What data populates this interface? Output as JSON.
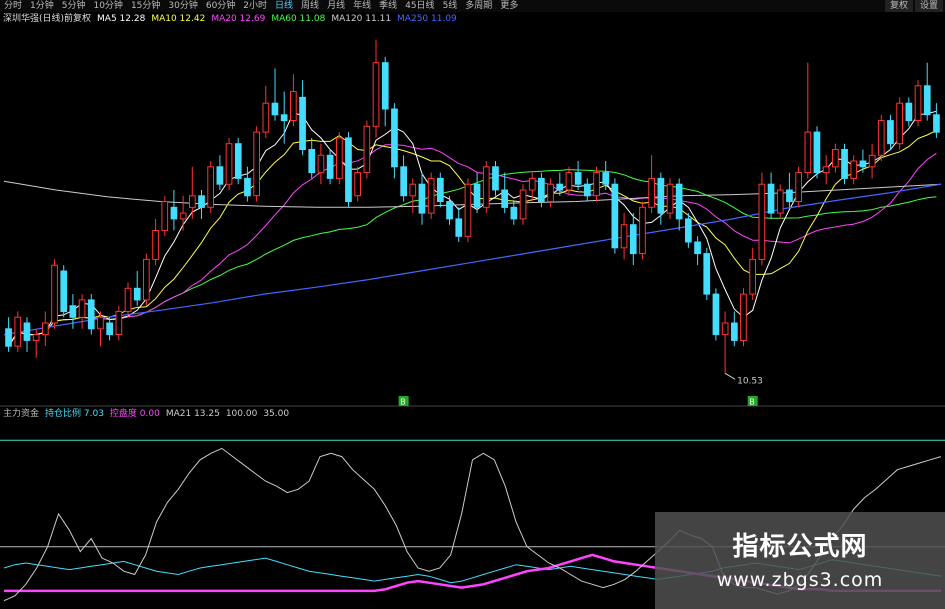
{
  "toolbar": {
    "items": [
      "分时",
      "1分钟",
      "5分钟",
      "10分钟",
      "15分钟",
      "30分钟",
      "60分钟",
      "2小时",
      "日线",
      "周线",
      "月线",
      "年线",
      "季线",
      "45日线",
      "5线",
      "多周期",
      "更多"
    ],
    "active_index": 8,
    "right": [
      "复权",
      "设置"
    ]
  },
  "ma_legend": [
    {
      "text": "深圳华强(日线)前复权",
      "color": "#dddddd"
    },
    {
      "text": "MA5 12.28",
      "color": "#ffffff"
    },
    {
      "text": "MA10 12.42",
      "color": "#ffff44"
    },
    {
      "text": "MA20 12.69",
      "color": "#ff44ff"
    },
    {
      "text": "MA60 11.08",
      "color": "#44ff44"
    },
    {
      "text": "MA120 11.11",
      "color": "#cccccc"
    },
    {
      "text": "MA250 11.09",
      "color": "#4466ff"
    }
  ],
  "ind_legend": [
    {
      "text": "主力资金",
      "color": "#bbbbbb"
    },
    {
      "text": "持仓比例 7.03",
      "color": "#44ddff"
    },
    {
      "text": "控盘度 0.00",
      "color": "#ff44ff"
    },
    {
      "text": "MA21 13.25",
      "color": "#cccccc"
    },
    {
      "text": "100.00",
      "color": "#cccccc"
    },
    {
      "text": "35.00",
      "color": "#cccccc"
    }
  ],
  "annotations": {
    "low_price": "10.53",
    "buy_1": "B",
    "buy_2": "B"
  },
  "watermark": {
    "title": "指标公式网",
    "url": "www.zbgs3.com"
  },
  "colors": {
    "up": "#ff3333",
    "down": "#44ddff",
    "ma5": "#ffffff",
    "ma10": "#ffff44",
    "ma20": "#ff44ff",
    "ma60": "#44ff44",
    "ma120": "#cccccc",
    "ma250": "#4466ff",
    "ref_line": "#40e0d0"
  },
  "chart_data": [
    {
      "type": "candlestick",
      "title": "深圳华强(日线)",
      "ylim": [
        10.0,
        16.5
      ],
      "ohlc": [
        [
          11.3,
          11.5,
          10.9,
          11.0
        ],
        [
          11.0,
          11.6,
          10.9,
          11.5
        ],
        [
          11.4,
          11.5,
          10.9,
          11.1
        ],
        [
          11.1,
          11.3,
          10.8,
          11.2
        ],
        [
          11.2,
          11.6,
          11.0,
          11.4
        ],
        [
          11.4,
          12.5,
          11.3,
          12.4
        ],
        [
          12.3,
          12.4,
          11.5,
          11.6
        ],
        [
          11.7,
          11.9,
          11.3,
          11.5
        ],
        [
          11.5,
          11.9,
          11.3,
          11.8
        ],
        [
          11.8,
          11.9,
          11.2,
          11.3
        ],
        [
          11.3,
          11.6,
          11.0,
          11.5
        ],
        [
          11.4,
          11.5,
          11.1,
          11.2
        ],
        [
          11.2,
          11.7,
          11.1,
          11.6
        ],
        [
          11.6,
          12.1,
          11.5,
          12.0
        ],
        [
          12.0,
          12.3,
          11.7,
          11.8
        ],
        [
          11.8,
          12.6,
          11.7,
          12.5
        ],
        [
          12.5,
          13.2,
          12.4,
          13.0
        ],
        [
          13.0,
          13.6,
          12.9,
          13.5
        ],
        [
          13.4,
          13.7,
          13.0,
          13.2
        ],
        [
          13.2,
          13.6,
          13.0,
          13.3
        ],
        [
          13.4,
          14.1,
          13.2,
          13.6
        ],
        [
          13.6,
          13.7,
          13.2,
          13.4
        ],
        [
          13.4,
          14.2,
          13.3,
          14.1
        ],
        [
          14.1,
          14.3,
          13.7,
          13.8
        ],
        [
          13.8,
          14.6,
          13.7,
          14.5
        ],
        [
          14.5,
          14.6,
          13.8,
          13.9
        ],
        [
          13.9,
          14.1,
          13.5,
          13.6
        ],
        [
          13.6,
          14.8,
          13.5,
          14.7
        ],
        [
          14.7,
          15.5,
          14.6,
          15.2
        ],
        [
          15.2,
          15.8,
          14.9,
          15.0
        ],
        [
          15.0,
          15.4,
          14.5,
          14.9
        ],
        [
          14.9,
          15.7,
          14.8,
          15.4
        ],
        [
          15.3,
          15.6,
          14.3,
          14.4
        ],
        [
          14.4,
          14.6,
          13.9,
          14.0
        ],
        [
          14.0,
          14.5,
          13.8,
          14.3
        ],
        [
          14.3,
          14.4,
          13.8,
          13.9
        ],
        [
          13.9,
          14.7,
          13.8,
          14.6
        ],
        [
          14.6,
          14.7,
          13.4,
          13.5
        ],
        [
          13.6,
          14.1,
          13.5,
          14.0
        ],
        [
          14.0,
          14.9,
          13.9,
          14.8
        ],
        [
          14.8,
          16.3,
          14.6,
          15.9
        ],
        [
          15.9,
          16.0,
          14.8,
          15.1
        ],
        [
          15.1,
          15.2,
          13.9,
          14.1
        ],
        [
          14.1,
          14.3,
          13.5,
          13.6
        ],
        [
          13.6,
          13.9,
          13.3,
          13.8
        ],
        [
          13.8,
          14.0,
          13.1,
          13.3
        ],
        [
          13.3,
          14.0,
          13.2,
          13.9
        ],
        [
          13.9,
          14.0,
          13.4,
          13.5
        ],
        [
          13.5,
          13.6,
          13.1,
          13.2
        ],
        [
          13.2,
          13.4,
          12.8,
          12.9
        ],
        [
          12.9,
          13.9,
          12.8,
          13.8
        ],
        [
          13.8,
          14.0,
          13.3,
          13.4
        ],
        [
          13.4,
          14.2,
          13.3,
          14.1
        ],
        [
          14.1,
          14.2,
          13.6,
          13.7
        ],
        [
          13.7,
          14.0,
          13.3,
          13.4
        ],
        [
          13.4,
          13.5,
          13.1,
          13.2
        ],
        [
          13.2,
          13.8,
          13.1,
          13.7
        ],
        [
          13.7,
          14.0,
          13.5,
          13.9
        ],
        [
          13.9,
          14.0,
          13.4,
          13.5
        ],
        [
          13.5,
          13.9,
          13.4,
          13.8
        ],
        [
          13.8,
          14.0,
          13.6,
          13.7
        ],
        [
          13.7,
          14.1,
          13.6,
          14.0
        ],
        [
          14.0,
          14.2,
          13.7,
          13.8
        ],
        [
          13.8,
          13.9,
          13.5,
          13.6
        ],
        [
          13.6,
          14.1,
          13.5,
          14.0
        ],
        [
          14.0,
          14.2,
          13.7,
          13.8
        ],
        [
          13.8,
          13.9,
          12.6,
          12.7
        ],
        [
          12.7,
          13.3,
          12.5,
          13.1
        ],
        [
          13.1,
          13.3,
          12.4,
          12.6
        ],
        [
          12.6,
          13.5,
          12.5,
          13.4
        ],
        [
          13.4,
          14.3,
          13.3,
          13.9
        ],
        [
          13.9,
          14.0,
          13.1,
          13.3
        ],
        [
          13.3,
          13.9,
          13.2,
          13.8
        ],
        [
          13.8,
          13.9,
          13.0,
          13.2
        ],
        [
          13.2,
          13.3,
          12.7,
          12.8
        ],
        [
          12.8,
          12.9,
          12.4,
          12.6
        ],
        [
          12.6,
          12.7,
          11.8,
          11.9
        ],
        [
          11.9,
          12.0,
          11.1,
          11.2
        ],
        [
          11.2,
          11.6,
          10.53,
          11.4
        ],
        [
          11.4,
          11.6,
          11.0,
          11.1
        ],
        [
          11.1,
          12.0,
          11.0,
          11.9
        ],
        [
          11.9,
          12.7,
          11.8,
          12.5
        ],
        [
          12.5,
          14.0,
          12.4,
          13.8
        ],
        [
          13.8,
          14.0,
          13.2,
          13.3
        ],
        [
          13.3,
          13.8,
          13.2,
          13.7
        ],
        [
          13.7,
          14.0,
          13.4,
          13.5
        ],
        [
          13.5,
          14.1,
          13.4,
          14.0
        ],
        [
          14.0,
          15.9,
          13.9,
          14.7
        ],
        [
          14.7,
          14.8,
          13.9,
          14.0
        ],
        [
          14.0,
          14.3,
          13.8,
          14.1
        ],
        [
          14.1,
          14.5,
          14.0,
          14.4
        ],
        [
          14.4,
          14.5,
          13.8,
          13.9
        ],
        [
          13.9,
          14.3,
          13.8,
          14.2
        ],
        [
          14.2,
          14.4,
          14.0,
          14.1
        ],
        [
          14.1,
          14.5,
          13.9,
          14.3
        ],
        [
          14.3,
          15.0,
          14.2,
          14.9
        ],
        [
          14.9,
          15.0,
          14.4,
          14.5
        ],
        [
          14.5,
          15.3,
          14.4,
          15.2
        ],
        [
          15.2,
          15.3,
          14.8,
          14.9
        ],
        [
          14.9,
          15.6,
          14.8,
          15.5
        ],
        [
          15.5,
          15.9,
          14.9,
          15.0
        ],
        [
          15.0,
          15.2,
          14.6,
          14.7
        ]
      ],
      "ma120": [
        13.85,
        13.7,
        13.58,
        13.5,
        13.45,
        13.42,
        13.4,
        13.4,
        13.42,
        13.45,
        13.48,
        13.5,
        13.55,
        13.6,
        13.62,
        13.65,
        13.7,
        13.75,
        13.8
      ],
      "ma250": [
        11.2,
        11.35,
        11.5,
        11.62,
        11.75,
        11.9,
        12.02,
        12.15,
        12.3,
        12.45,
        12.6,
        12.75,
        12.9,
        13.05,
        13.2,
        13.38,
        13.52,
        13.65,
        13.8
      ]
    },
    {
      "type": "line",
      "title": "主力资金",
      "ylim": [
        0,
        105
      ],
      "ref_lines": [
        100,
        35
      ],
      "series": [
        {
          "name": "持仓比例",
          "color": "#44ddff",
          "values": [
            22,
            24,
            25,
            24,
            23,
            22,
            21,
            22,
            23,
            24,
            25,
            26,
            24,
            22,
            20,
            19,
            18,
            20,
            22,
            23,
            24,
            25,
            26,
            27,
            28,
            26,
            24,
            22,
            20,
            19,
            18,
            17,
            16,
            15,
            14,
            15,
            16,
            17,
            18,
            17,
            15,
            13,
            14,
            16,
            18,
            20,
            22,
            24,
            23,
            22,
            21,
            22,
            23,
            22,
            21,
            20,
            19,
            18,
            17,
            16,
            15,
            16,
            17,
            18,
            19,
            20,
            22,
            23,
            24,
            25,
            24,
            23,
            22,
            21,
            23,
            25,
            27,
            26,
            25,
            24,
            23,
            22,
            21,
            20,
            19,
            18,
            17
          ]
        },
        {
          "name": "控盘度",
          "color": "#ff44ff",
          "values": [
            8,
            8,
            8,
            8,
            8,
            8,
            8,
            8,
            8,
            8,
            8,
            8,
            8,
            8,
            8,
            8,
            8,
            8,
            8,
            8,
            8,
            8,
            8,
            8,
            8,
            8,
            8,
            8,
            8,
            8,
            8,
            8,
            8,
            8,
            8,
            9,
            11,
            13,
            14,
            13,
            12,
            11,
            10,
            11,
            12,
            14,
            16,
            18,
            20,
            21,
            22,
            24,
            26,
            28,
            30,
            28,
            26,
            25,
            24,
            23,
            22,
            21,
            20,
            19,
            18,
            17,
            16,
            15,
            14,
            13,
            12,
            11,
            10,
            9,
            9,
            9,
            8,
            8,
            8,
            8,
            8,
            8,
            8,
            8,
            8,
            8,
            8
          ]
        },
        {
          "name": "MA21",
          "color": "#cccccc",
          "values": [
            2,
            5,
            12,
            22,
            35,
            55,
            45,
            32,
            40,
            28,
            25,
            20,
            18,
            30,
            50,
            62,
            70,
            80,
            88,
            92,
            95,
            90,
            85,
            80,
            75,
            72,
            68,
            70,
            75,
            90,
            92,
            90,
            82,
            76,
            70,
            60,
            48,
            32,
            22,
            20,
            22,
            30,
            55,
            88,
            92,
            88,
            72,
            50,
            35,
            30,
            25,
            22,
            18,
            14,
            12,
            10,
            12,
            15,
            20,
            26,
            32,
            38,
            45,
            42,
            40,
            35,
            18,
            12,
            10,
            10,
            8,
            6,
            8,
            12,
            20,
            30,
            40,
            48,
            58,
            65,
            70,
            76,
            82,
            84,
            86,
            88,
            90
          ]
        }
      ]
    }
  ]
}
